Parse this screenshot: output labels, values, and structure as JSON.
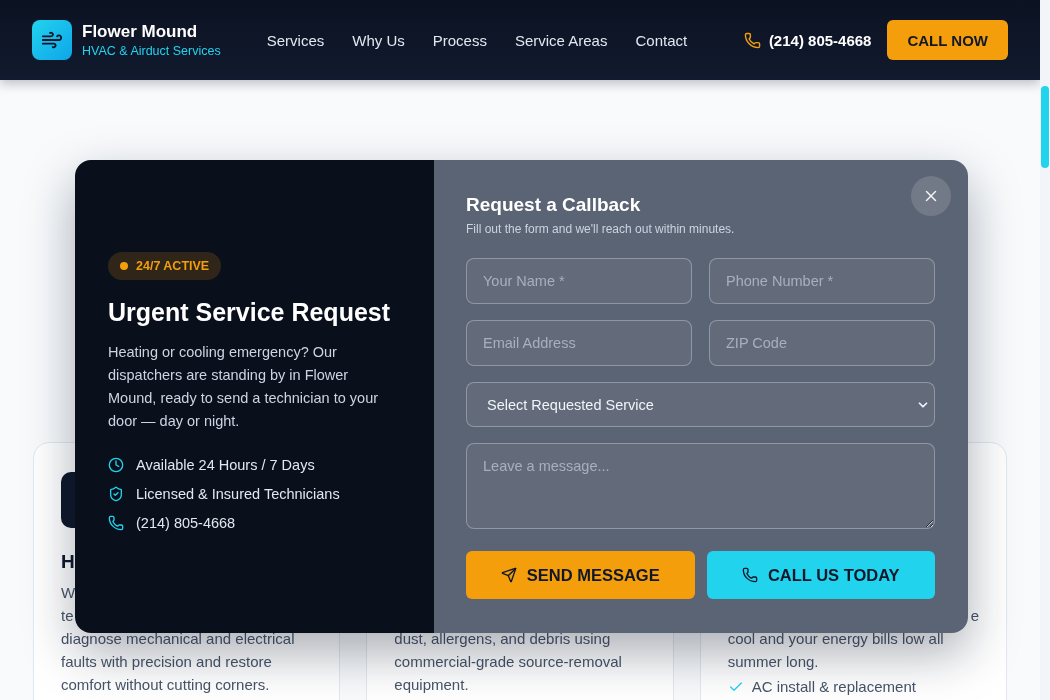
{
  "nav": {
    "brand": {
      "name": "Flower Mound",
      "tagline": "HVAC & Airduct Services"
    },
    "links": [
      "Services",
      "Why Us",
      "Process",
      "Service Areas",
      "Contact"
    ],
    "phone": "(214) 805-4668",
    "cta": "CALL NOW"
  },
  "cards": [
    {
      "tile": true,
      "heading": "H",
      "lines": [
        {
          "kind": "line",
          "text": "W"
        },
        {
          "kind": "line",
          "text": "te"
        },
        {
          "kind": "line",
          "text": "diagnose mechanical and electrical"
        },
        {
          "kind": "line",
          "text": "faults with precision and restore"
        },
        {
          "kind": "line",
          "text": "comfort without cutting corners."
        }
      ]
    },
    {
      "tile": false,
      "lines": [
        {
          "kind": "gap"
        },
        {
          "kind": "gap"
        },
        {
          "kind": "line",
          "text": "dust, allergens, and debris using"
        },
        {
          "kind": "line",
          "text": "commercial-grade source-removal"
        },
        {
          "kind": "line",
          "text": "equipment."
        }
      ]
    },
    {
      "tile": false,
      "lines": [
        {
          "kind": "gap"
        },
        {
          "kind": "tail",
          "text": "e"
        },
        {
          "kind": "line",
          "text": "cool and your energy bills low all"
        },
        {
          "kind": "line",
          "text": "summer long."
        },
        {
          "kind": "check",
          "text": "AC install & replacement"
        }
      ]
    }
  ],
  "modal": {
    "left": {
      "badge": "24/7 ACTIVE",
      "title": "Urgent Service Request",
      "text": "Heating or cooling emergency? Our dispatchers are standing by in Flower Mound, ready to send a technician to your door — day or night.",
      "features": [
        {
          "kind": "clock",
          "text": "Available 24 Hours / 7 Days"
        },
        {
          "kind": "shield",
          "text": "Licensed & Insured Technicians"
        },
        {
          "kind": "phone",
          "text": "(214) 805-4668"
        }
      ]
    },
    "form": {
      "title": "Request a Callback",
      "subtitle": "Fill out the form and we'll reach out within minutes.",
      "fields": [
        {
          "placeholder": "Your Name *"
        },
        {
          "placeholder": "Phone Number *"
        },
        {
          "placeholder": "Email Address"
        },
        {
          "placeholder": "ZIP Code"
        }
      ],
      "select": "Select Requested Service",
      "message": {
        "placeholder": "Leave a message..."
      },
      "buttons": [
        {
          "kind": "send",
          "label": "SEND MESSAGE"
        },
        {
          "kind": "call",
          "label": "CALL US TODAY"
        }
      ]
    }
  }
}
